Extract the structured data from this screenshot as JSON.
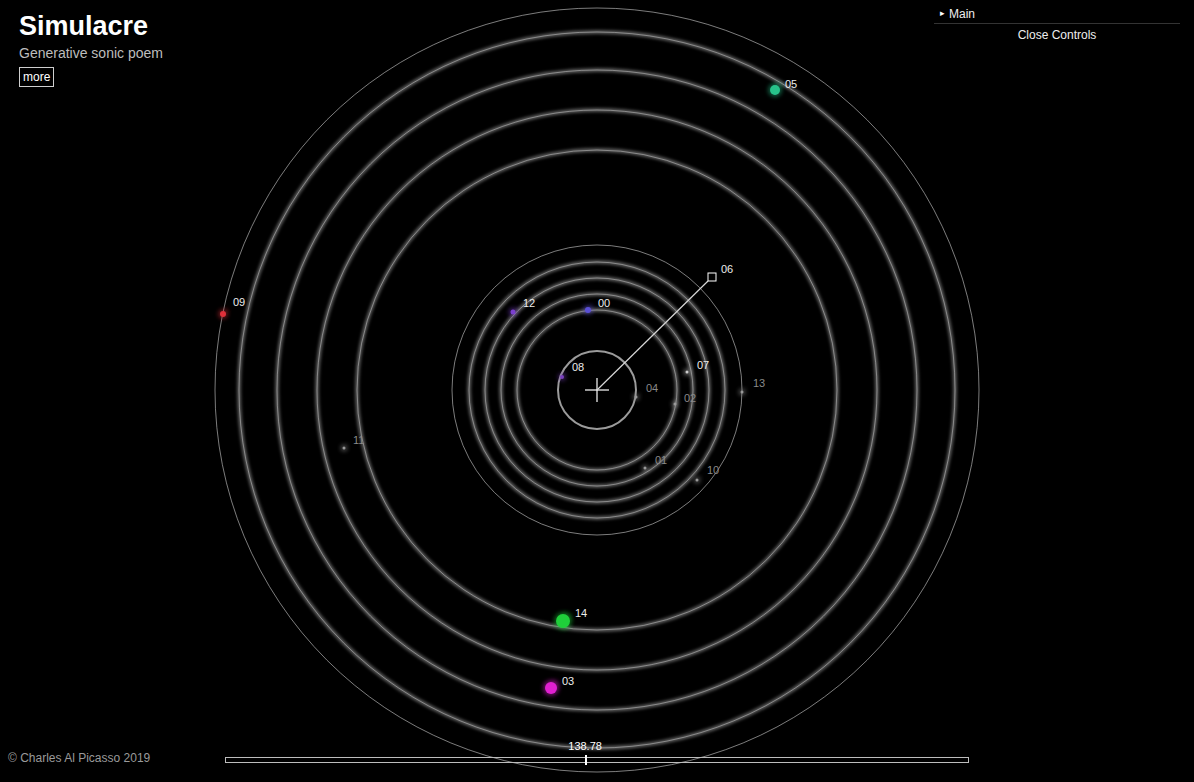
{
  "app": {
    "title": "Simulacre",
    "subtitle": "Generative sonic poem",
    "more_button": "more",
    "copyright": "© Charles Al Picasso 2019"
  },
  "controls": {
    "folder_icon": "▸",
    "folder": "Main",
    "expanded": false,
    "close_button": "Close Controls"
  },
  "timeline": {
    "reading": "138.78",
    "level": 0.484
  },
  "planets": [
    {
      "label": "05",
      "color": "#27c28a",
      "dimmed": false,
      "selected": false
    },
    {
      "label": "09",
      "color": "#e0303a",
      "dimmed": false,
      "selected": false
    },
    {
      "label": "12",
      "color": "#7b3fd0",
      "dimmed": false,
      "selected": false
    },
    {
      "label": "00",
      "color": "#5a4fd6",
      "dimmed": false,
      "selected": false
    },
    {
      "label": "08",
      "color": "#7a3fc0",
      "dimmed": false,
      "selected": false
    },
    {
      "label": "06",
      "color": "#ffffff",
      "dimmed": false,
      "selected": true
    },
    {
      "label": "07",
      "color": "#cccccc",
      "dimmed": false,
      "selected": false
    },
    {
      "label": "04",
      "color": "#999999",
      "dimmed": true,
      "selected": false
    },
    {
      "label": "02",
      "color": "#999999",
      "dimmed": true,
      "selected": false
    },
    {
      "label": "13",
      "color": "#999999",
      "dimmed": true,
      "selected": false
    },
    {
      "label": "01",
      "color": "#999999",
      "dimmed": true,
      "selected": false
    },
    {
      "label": "10",
      "color": "#999999",
      "dimmed": true,
      "selected": false
    },
    {
      "label": "11",
      "color": "#999999",
      "dimmed": true,
      "selected": false
    },
    {
      "label": "14",
      "color": "#1fcf3a",
      "dimmed": false,
      "selected": false
    },
    {
      "label": "03",
      "color": "#e020d0",
      "dimmed": false,
      "selected": false
    }
  ]
}
